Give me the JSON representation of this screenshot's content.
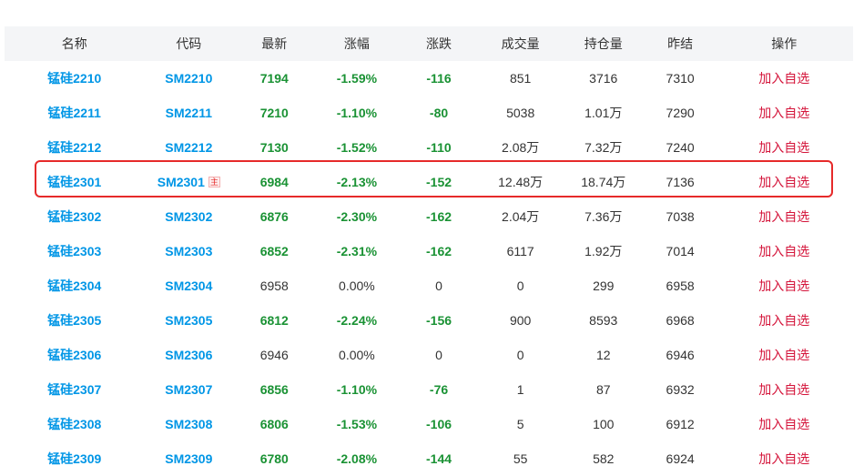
{
  "header": {
    "name": "名称",
    "code": "代码",
    "last": "最新",
    "change_pct": "涨幅",
    "change": "涨跌",
    "volume": "成交量",
    "open_interest": "持仓量",
    "prev_settle": "昨结",
    "action": "操作"
  },
  "rows": [
    {
      "name": "锰硅2210",
      "code": "SM2210",
      "badge": "",
      "last": "7194",
      "change_pct": "-1.59%",
      "change": "-116",
      "volume": "851",
      "open_interest": "3716",
      "prev_settle": "7310",
      "action": "加入自选",
      "trend": "down"
    },
    {
      "name": "锰硅2211",
      "code": "SM2211",
      "badge": "",
      "last": "7210",
      "change_pct": "-1.10%",
      "change": "-80",
      "volume": "5038",
      "open_interest": "1.01万",
      "prev_settle": "7290",
      "action": "加入自选",
      "trend": "down"
    },
    {
      "name": "锰硅2212",
      "code": "SM2212",
      "badge": "",
      "last": "7130",
      "change_pct": "-1.52%",
      "change": "-110",
      "volume": "2.08万",
      "open_interest": "7.32万",
      "prev_settle": "7240",
      "action": "加入自选",
      "trend": "down"
    },
    {
      "name": "锰硅2301",
      "code": "SM2301",
      "badge": "主",
      "last": "6984",
      "change_pct": "-2.13%",
      "change": "-152",
      "volume": "12.48万",
      "open_interest": "18.74万",
      "prev_settle": "7136",
      "action": "加入自选",
      "trend": "down"
    },
    {
      "name": "锰硅2302",
      "code": "SM2302",
      "badge": "",
      "last": "6876",
      "change_pct": "-2.30%",
      "change": "-162",
      "volume": "2.04万",
      "open_interest": "7.36万",
      "prev_settle": "7038",
      "action": "加入自选",
      "trend": "down"
    },
    {
      "name": "锰硅2303",
      "code": "SM2303",
      "badge": "",
      "last": "6852",
      "change_pct": "-2.31%",
      "change": "-162",
      "volume": "6117",
      "open_interest": "1.92万",
      "prev_settle": "7014",
      "action": "加入自选",
      "trend": "down"
    },
    {
      "name": "锰硅2304",
      "code": "SM2304",
      "badge": "",
      "last": "6958",
      "change_pct": "0.00%",
      "change": "0",
      "volume": "0",
      "open_interest": "299",
      "prev_settle": "6958",
      "action": "加入自选",
      "trend": "flat"
    },
    {
      "name": "锰硅2305",
      "code": "SM2305",
      "badge": "",
      "last": "6812",
      "change_pct": "-2.24%",
      "change": "-156",
      "volume": "900",
      "open_interest": "8593",
      "prev_settle": "6968",
      "action": "加入自选",
      "trend": "down"
    },
    {
      "name": "锰硅2306",
      "code": "SM2306",
      "badge": "",
      "last": "6946",
      "change_pct": "0.00%",
      "change": "0",
      "volume": "0",
      "open_interest": "12",
      "prev_settle": "6946",
      "action": "加入自选",
      "trend": "flat"
    },
    {
      "name": "锰硅2307",
      "code": "SM2307",
      "badge": "",
      "last": "6856",
      "change_pct": "-1.10%",
      "change": "-76",
      "volume": "1",
      "open_interest": "87",
      "prev_settle": "6932",
      "action": "加入自选",
      "trend": "down"
    },
    {
      "name": "锰硅2308",
      "code": "SM2308",
      "badge": "",
      "last": "6806",
      "change_pct": "-1.53%",
      "change": "-106",
      "volume": "5",
      "open_interest": "100",
      "prev_settle": "6912",
      "action": "加入自选",
      "trend": "down"
    },
    {
      "name": "锰硅2309",
      "code": "SM2309",
      "badge": "",
      "last": "6780",
      "change_pct": "-2.08%",
      "change": "-144",
      "volume": "55",
      "open_interest": "582",
      "prev_settle": "6924",
      "action": "加入自选",
      "trend": "down"
    }
  ],
  "highlighted_row": "锰硅2301",
  "colors": {
    "link": "#0096e6",
    "down": "#1a9234",
    "flat": "#333333",
    "action": "#d4143a",
    "highlight_border": "#e62a2a",
    "header_bg": "#f4f5f7"
  }
}
